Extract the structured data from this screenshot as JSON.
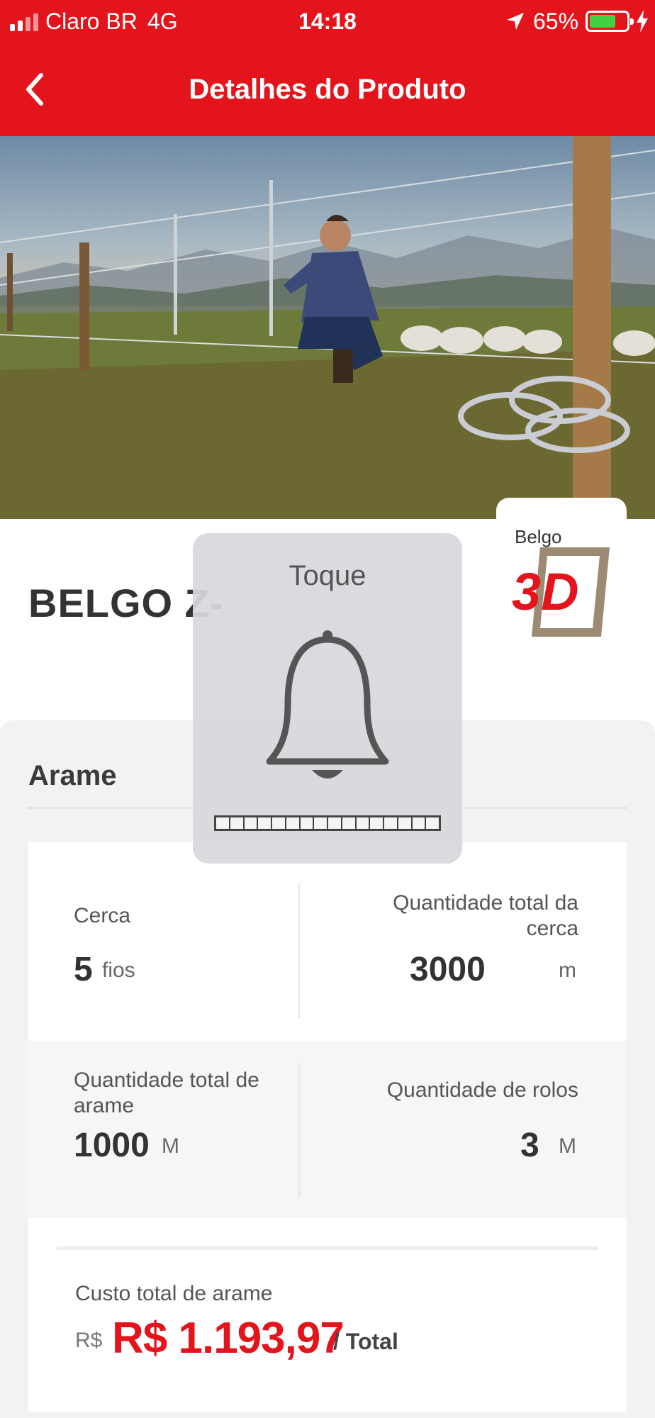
{
  "status_bar": {
    "carrier": "Claro BR",
    "network": "4G",
    "time": "14:18",
    "battery_percent": "65%",
    "battery_color": "#3fd13f",
    "icons": [
      "signal-icon",
      "location-arrow-icon",
      "battery-icon",
      "charging-bolt-icon"
    ]
  },
  "header": {
    "title": "Detalhes do Produto",
    "background": "#e3141b",
    "back_icon": "chevron-left-icon"
  },
  "product": {
    "title": "BELGO Z-",
    "logo_text": "Belgo",
    "logo_mark": "3D"
  },
  "section": {
    "title": "Arame"
  },
  "fields": {
    "fence": {
      "label": "Cerca",
      "value": "5",
      "unit": "fios"
    },
    "fence_total": {
      "label": "Quantidade total da cerca",
      "value": "3000",
      "unit": "m"
    },
    "wire_total": {
      "label": "Quantidade total de arame",
      "value": "1000",
      "unit": "M"
    },
    "rolls": {
      "label": "Quantidade de rolos",
      "value": "3",
      "unit": "M"
    }
  },
  "cost": {
    "label": "Custo total de arame",
    "currency": "R$",
    "value": "R$ 1.193,97",
    "suffix": "/ Total",
    "accent": "#e3141b"
  },
  "ringer_hud": {
    "title": "Toque",
    "icon": "bell-icon",
    "level": 0
  }
}
